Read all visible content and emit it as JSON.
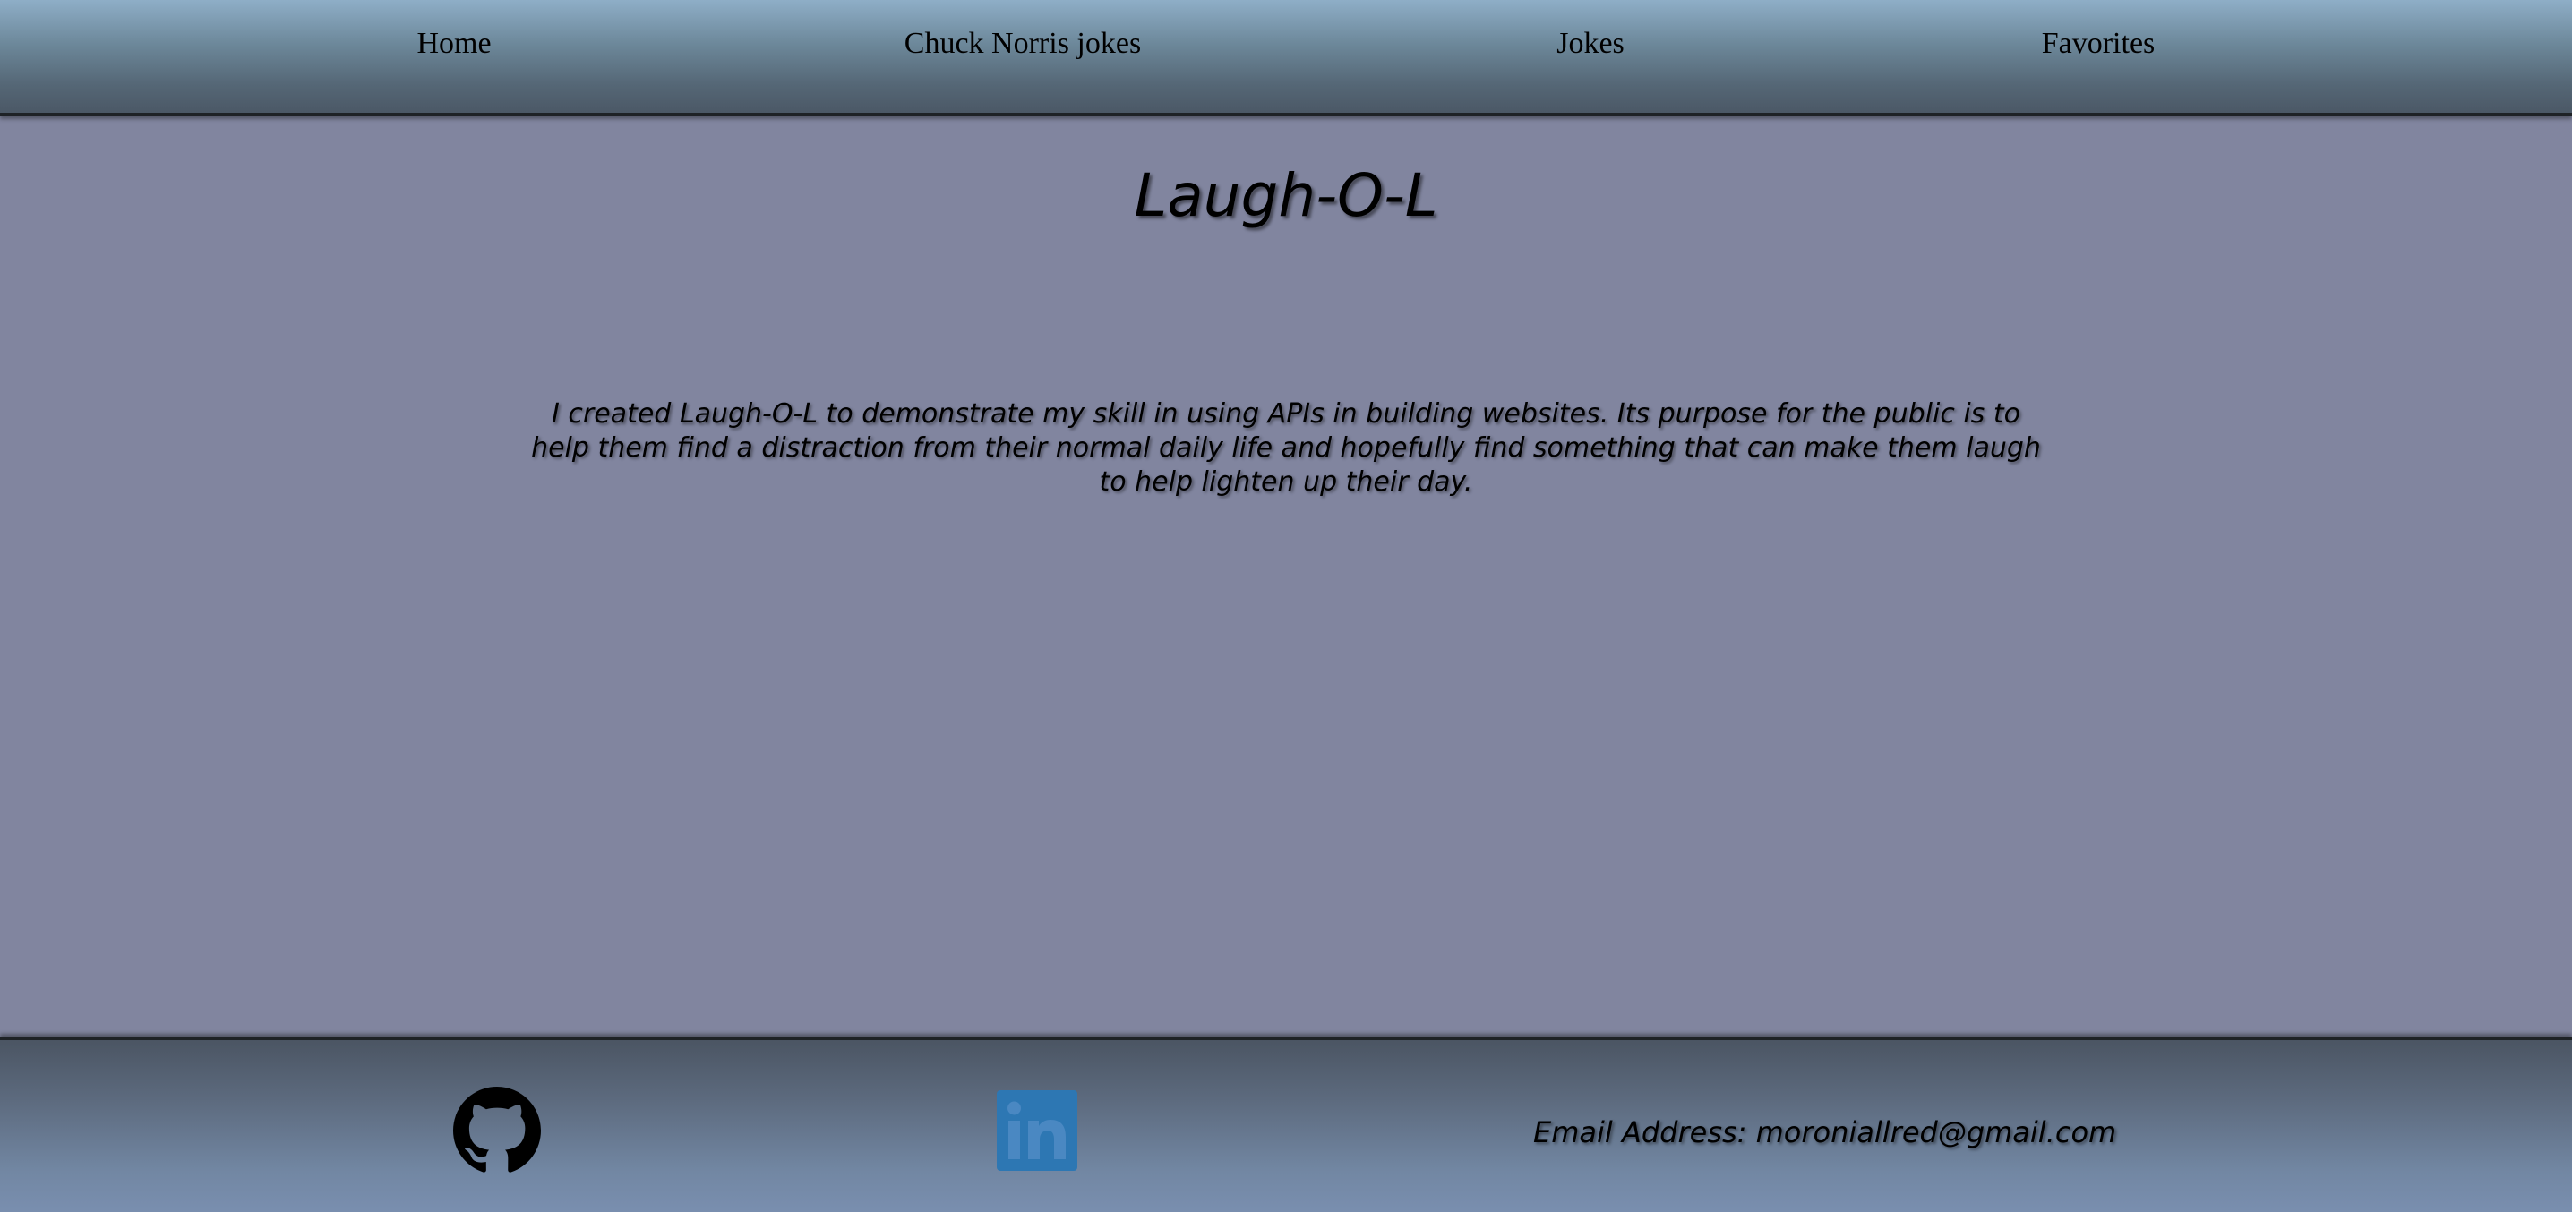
{
  "nav": {
    "items": [
      {
        "label": "Home"
      },
      {
        "label": "Chuck Norris jokes"
      },
      {
        "label": "Jokes"
      },
      {
        "label": "Favorites"
      }
    ]
  },
  "main": {
    "title": "Laugh-O-L",
    "description": "I created Laugh-O-L to demonstrate my skill in using APIs in building websites. Its purpose for the public is to help them find a distraction from their normal daily life and hopefully find something that can make them laugh to help lighten up their day."
  },
  "footer": {
    "github_icon": "github-icon",
    "linkedin_icon": "linkedin-icon",
    "email_text": "Email Address: moroniallred@gmail.com"
  },
  "colors": {
    "background": "#81859f",
    "linkedin": "#2d77b3"
  }
}
